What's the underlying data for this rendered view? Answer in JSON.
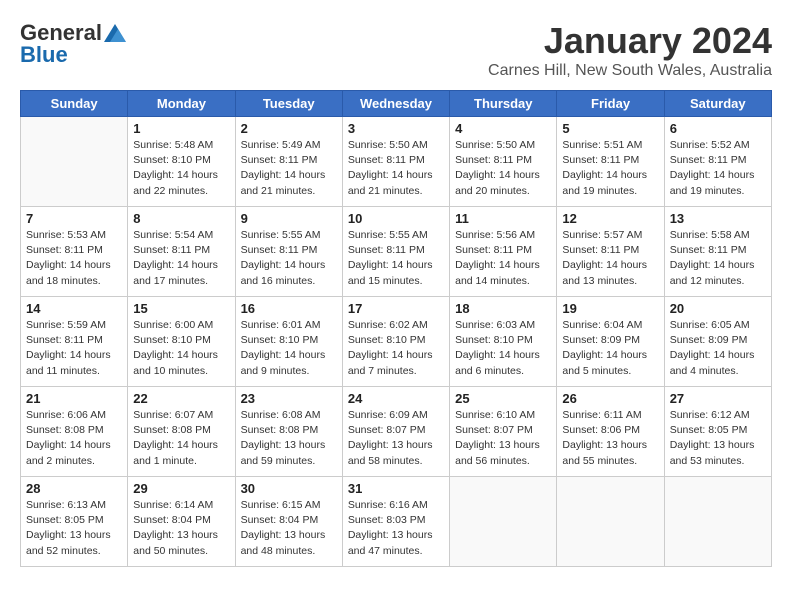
{
  "header": {
    "logo_line1": "General",
    "logo_line2": "Blue",
    "main_title": "January 2024",
    "subtitle": "Carnes Hill, New South Wales, Australia"
  },
  "days_of_week": [
    "Sunday",
    "Monday",
    "Tuesday",
    "Wednesday",
    "Thursday",
    "Friday",
    "Saturday"
  ],
  "weeks": [
    [
      {
        "day": "",
        "info": ""
      },
      {
        "day": "1",
        "info": "Sunrise: 5:48 AM\nSunset: 8:10 PM\nDaylight: 14 hours\nand 22 minutes."
      },
      {
        "day": "2",
        "info": "Sunrise: 5:49 AM\nSunset: 8:11 PM\nDaylight: 14 hours\nand 21 minutes."
      },
      {
        "day": "3",
        "info": "Sunrise: 5:50 AM\nSunset: 8:11 PM\nDaylight: 14 hours\nand 21 minutes."
      },
      {
        "day": "4",
        "info": "Sunrise: 5:50 AM\nSunset: 8:11 PM\nDaylight: 14 hours\nand 20 minutes."
      },
      {
        "day": "5",
        "info": "Sunrise: 5:51 AM\nSunset: 8:11 PM\nDaylight: 14 hours\nand 19 minutes."
      },
      {
        "day": "6",
        "info": "Sunrise: 5:52 AM\nSunset: 8:11 PM\nDaylight: 14 hours\nand 19 minutes."
      }
    ],
    [
      {
        "day": "7",
        "info": "Sunrise: 5:53 AM\nSunset: 8:11 PM\nDaylight: 14 hours\nand 18 minutes."
      },
      {
        "day": "8",
        "info": "Sunrise: 5:54 AM\nSunset: 8:11 PM\nDaylight: 14 hours\nand 17 minutes."
      },
      {
        "day": "9",
        "info": "Sunrise: 5:55 AM\nSunset: 8:11 PM\nDaylight: 14 hours\nand 16 minutes."
      },
      {
        "day": "10",
        "info": "Sunrise: 5:55 AM\nSunset: 8:11 PM\nDaylight: 14 hours\nand 15 minutes."
      },
      {
        "day": "11",
        "info": "Sunrise: 5:56 AM\nSunset: 8:11 PM\nDaylight: 14 hours\nand 14 minutes."
      },
      {
        "day": "12",
        "info": "Sunrise: 5:57 AM\nSunset: 8:11 PM\nDaylight: 14 hours\nand 13 minutes."
      },
      {
        "day": "13",
        "info": "Sunrise: 5:58 AM\nSunset: 8:11 PM\nDaylight: 14 hours\nand 12 minutes."
      }
    ],
    [
      {
        "day": "14",
        "info": "Sunrise: 5:59 AM\nSunset: 8:11 PM\nDaylight: 14 hours\nand 11 minutes."
      },
      {
        "day": "15",
        "info": "Sunrise: 6:00 AM\nSunset: 8:10 PM\nDaylight: 14 hours\nand 10 minutes."
      },
      {
        "day": "16",
        "info": "Sunrise: 6:01 AM\nSunset: 8:10 PM\nDaylight: 14 hours\nand 9 minutes."
      },
      {
        "day": "17",
        "info": "Sunrise: 6:02 AM\nSunset: 8:10 PM\nDaylight: 14 hours\nand 7 minutes."
      },
      {
        "day": "18",
        "info": "Sunrise: 6:03 AM\nSunset: 8:10 PM\nDaylight: 14 hours\nand 6 minutes."
      },
      {
        "day": "19",
        "info": "Sunrise: 6:04 AM\nSunset: 8:09 PM\nDaylight: 14 hours\nand 5 minutes."
      },
      {
        "day": "20",
        "info": "Sunrise: 6:05 AM\nSunset: 8:09 PM\nDaylight: 14 hours\nand 4 minutes."
      }
    ],
    [
      {
        "day": "21",
        "info": "Sunrise: 6:06 AM\nSunset: 8:08 PM\nDaylight: 14 hours\nand 2 minutes."
      },
      {
        "day": "22",
        "info": "Sunrise: 6:07 AM\nSunset: 8:08 PM\nDaylight: 14 hours\nand 1 minute."
      },
      {
        "day": "23",
        "info": "Sunrise: 6:08 AM\nSunset: 8:08 PM\nDaylight: 13 hours\nand 59 minutes."
      },
      {
        "day": "24",
        "info": "Sunrise: 6:09 AM\nSunset: 8:07 PM\nDaylight: 13 hours\nand 58 minutes."
      },
      {
        "day": "25",
        "info": "Sunrise: 6:10 AM\nSunset: 8:07 PM\nDaylight: 13 hours\nand 56 minutes."
      },
      {
        "day": "26",
        "info": "Sunrise: 6:11 AM\nSunset: 8:06 PM\nDaylight: 13 hours\nand 55 minutes."
      },
      {
        "day": "27",
        "info": "Sunrise: 6:12 AM\nSunset: 8:05 PM\nDaylight: 13 hours\nand 53 minutes."
      }
    ],
    [
      {
        "day": "28",
        "info": "Sunrise: 6:13 AM\nSunset: 8:05 PM\nDaylight: 13 hours\nand 52 minutes."
      },
      {
        "day": "29",
        "info": "Sunrise: 6:14 AM\nSunset: 8:04 PM\nDaylight: 13 hours\nand 50 minutes."
      },
      {
        "day": "30",
        "info": "Sunrise: 6:15 AM\nSunset: 8:04 PM\nDaylight: 13 hours\nand 48 minutes."
      },
      {
        "day": "31",
        "info": "Sunrise: 6:16 AM\nSunset: 8:03 PM\nDaylight: 13 hours\nand 47 minutes."
      },
      {
        "day": "",
        "info": ""
      },
      {
        "day": "",
        "info": ""
      },
      {
        "day": "",
        "info": ""
      }
    ]
  ]
}
